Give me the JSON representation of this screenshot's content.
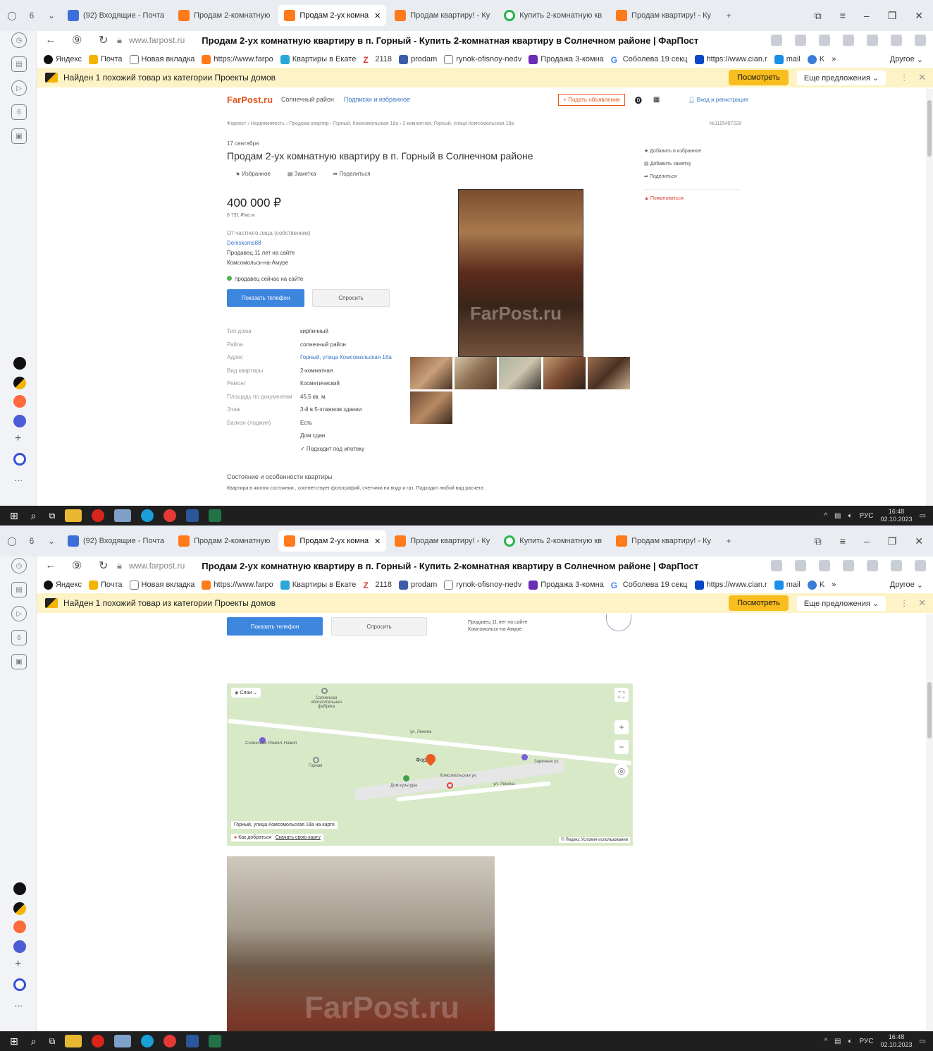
{
  "browser": {
    "tab_count": "6",
    "tabs": [
      {
        "label": "(92) Входящие - Почта",
        "icon": "mail-icon"
      },
      {
        "label": "Продам 2-комнатную",
        "icon": "farpost-icon"
      },
      {
        "label": "Продам 2-ух комна",
        "icon": "farpost-icon",
        "active": true
      },
      {
        "label": "Продам квартиру! - Ку",
        "icon": "farpost-icon"
      },
      {
        "label": "Купить 2-комнатную кв",
        "icon": "cian-icon"
      },
      {
        "label": "Продам квартиру! - Ку",
        "icon": "farpost-icon"
      }
    ],
    "domain": "www.farpost.ru",
    "page_title": "Продам 2-ух комнатную квартиру в п. Горный - Купить 2-комнатная квартиру в Солнечном районе | ФарПост",
    "bookmarks": [
      "Яндекс",
      "Почта",
      "Новая вкладка",
      "https://www.farpo",
      "Квартиры в Екате",
      "2118",
      "prodam",
      "rynok-ofisnoy-nedv",
      "Продажа 3-комна",
      "Соболева 19 секц",
      "https://www.cian.r",
      "mail",
      "K"
    ],
    "bookmarks_more": "»",
    "bookmarks_other": "Другое",
    "notification": {
      "text": "Найден 1 похожий товар из категории Проекты домов",
      "view_button": "Посмотреть",
      "more_button": "Еще предложения"
    },
    "tray": {
      "lang": "РУС",
      "time": "16:48",
      "date": "02.10.2023"
    },
    "colors": {
      "accent": "#e8571d",
      "blue_button": "#3d86de",
      "notif_bg": "#fdf3c7",
      "notif_button": "#f8bd1e"
    }
  },
  "farpost": {
    "header": {
      "logo": "FarPost.ru",
      "region_link": "Солнечный район",
      "subscriptions_link": "Подписки и избранное",
      "post_ad_button": "+ Подать объявление",
      "login_link": "Вход и регистрация"
    },
    "breadcrumbs": "Фарпост › Недвижимость › Продажа квартир › Горный, Комсомольская 18а › 2-комнатная, Горный, улица Комсомольская 18а",
    "ad_id": "№1115497228",
    "date": "17 сентября",
    "title": "Продам 2-ух комнатную квартиру в п. Горный в Солнечном районе",
    "actions": {
      "favorite": "Избранное",
      "note": "Заметка",
      "share": "Поделиться"
    },
    "price": "400 000 ₽",
    "price_per_m2": "8 791 ₽/кв.м",
    "seller": {
      "type": "От частного лица (собственник)",
      "name": "Deniskoms88",
      "tenure": "Продавец 11 лет на сайте",
      "city": "Комсомольск-на-Амуре",
      "online": "продавец сейчас на сайте"
    },
    "show_phone_button": "Показать телефон",
    "ask_button": "Спросить",
    "props": [
      {
        "k": "Тип дома",
        "v": "кирпичный"
      },
      {
        "k": "Район",
        "v": "солнечный район"
      },
      {
        "k": "Адрес",
        "v": "Горный, улица Комсомольская 18а",
        "link": true
      },
      {
        "k": "Вид квартиры",
        "v": "2-комнатная"
      },
      {
        "k": "Ремонт",
        "v": "Косметический"
      },
      {
        "k": "Площадь по документам",
        "v": "45,5 кв. м."
      },
      {
        "k": "Этаж",
        "v": "3-й в 5-этажном здании"
      },
      {
        "k": "Балкон (лоджия)",
        "v": "Есть"
      },
      {
        "k": "",
        "v": "Дом сдан"
      },
      {
        "k": "",
        "v": "✓ Подходит под ипотеку"
      }
    ],
    "desc_title": "Состояние и особенности квартиры",
    "description": "Квартира в жилом состоянии , соответствует фотографий, счетчики на воду и газ. Подходит любой вид расчета .",
    "watermark": "FarPost.ru",
    "aside": {
      "add_favorite": "Добавить в избранное",
      "add_note": "Добавить заметку",
      "share": "Поделиться",
      "report": "Пожаловаться"
    },
    "map": {
      "layers": "Слои",
      "address_caption": "Горный, улица Комсомольская 18а на карте",
      "route": "Как добраться",
      "save_map": "Скачать свою карту",
      "copyright": "© Яндекс Условия использования",
      "labels": [
        "Солнечная обогатительная фабрика",
        "Солнечное Ремонт-Нажил",
        "Горная",
        "Фор",
        "ул. Ленина",
        "Дом культуры",
        "ул. Ленина",
        "Комсомольская ул.",
        "Заречная ул."
      ]
    }
  }
}
